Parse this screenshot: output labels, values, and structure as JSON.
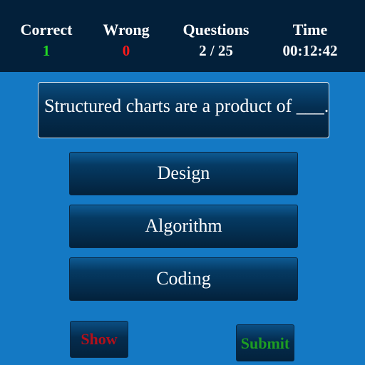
{
  "stats": {
    "correct": {
      "label": "Correct",
      "value": "1"
    },
    "wrong": {
      "label": "Wrong",
      "value": "0"
    },
    "questions": {
      "label": "Questions",
      "value": "2 / 25"
    },
    "time": {
      "label": "Time",
      "value": "00:12:42"
    }
  },
  "question": {
    "text": "Structured charts are a product of ___."
  },
  "options": [
    {
      "label": "Design"
    },
    {
      "label": "Algorithm"
    },
    {
      "label": "Coding"
    }
  ],
  "actions": {
    "show_label": "Show",
    "submit_label": "Submit"
  },
  "colors": {
    "background": "#1479c4",
    "header": "#03203a",
    "correct_value": "#23d923",
    "wrong_value": "#ff1a1a",
    "show_text": "#b3101a",
    "submit_text": "#1e9d22"
  }
}
